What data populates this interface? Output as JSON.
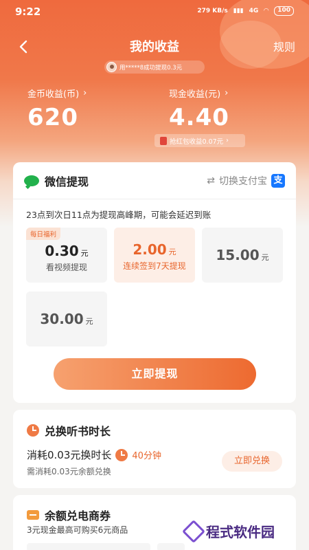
{
  "status_bar": {
    "time": "9:22",
    "speed": "279 KB/s",
    "network": "4G",
    "battery": "100"
  },
  "header": {
    "title": "我的收益",
    "rules_label": "规则"
  },
  "ticker": {
    "text": "用*****8成功提现0.3元"
  },
  "coin": {
    "label": "金币收益(币)",
    "value": "620"
  },
  "cash": {
    "label": "现金收益(元)",
    "value": "4.40"
  },
  "redpacket": {
    "text": "抢红包收益0.07元"
  },
  "withdraw": {
    "title": "微信提现",
    "switch_label": "切换支付宝",
    "alipay_glyph": "支",
    "notice": "23点到次日11点为提现高峰期，可能会延迟到账",
    "unit": "元",
    "options": [
      {
        "tag": "每日福利",
        "amount": "0.30",
        "sub": "看视频提现",
        "selected": false
      },
      {
        "tag": "",
        "amount": "2.00",
        "sub": "连续签到7天提现",
        "selected": true
      },
      {
        "tag": "",
        "amount": "15.00",
        "sub": "",
        "selected": false
      },
      {
        "tag": "",
        "amount": "30.00",
        "sub": "",
        "selected": false
      }
    ],
    "button_label": "立即提现"
  },
  "exchange": {
    "title": "兑换听书时长",
    "line": "消耗0.03元换时长",
    "minutes": "40分钟",
    "sub": "需消耗0.03元余额兑换",
    "button_label": "立即兑换"
  },
  "ecommerce": {
    "title": "余额兑电商券",
    "sub": "3元现金最高可购买6元商品"
  },
  "watermark": {
    "text": "程式软件园"
  },
  "colors": {
    "accent": "#ed6a30",
    "wechat": "#22b14c",
    "alipay": "#1677ff"
  }
}
